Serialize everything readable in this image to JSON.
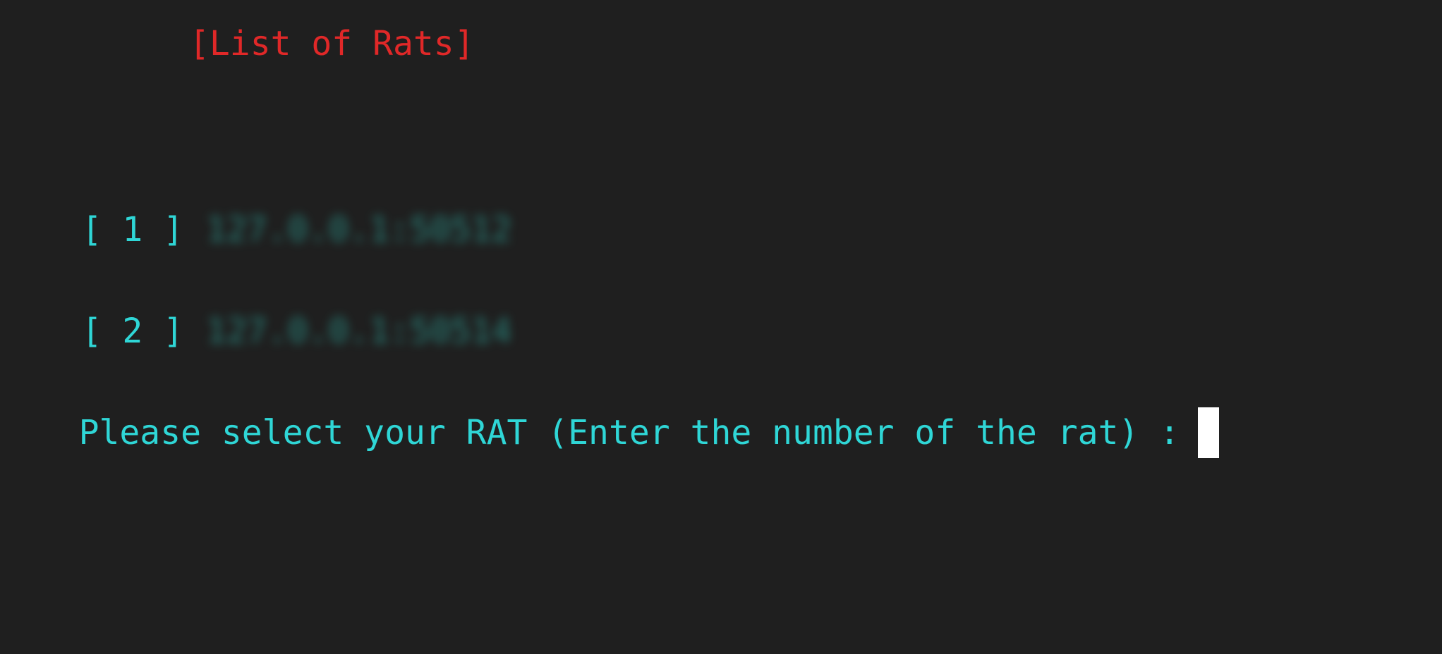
{
  "title": "[List of Rats]",
  "rats": [
    {
      "index": "[ 1 ]",
      "address": "127.0.0.1:50512"
    },
    {
      "index": "[ 2 ]",
      "address": "127.0.0.1:50514"
    }
  ],
  "prompt": "Please select your RAT (Enter the number of the rat) :",
  "colors": {
    "background": "#1f1f1f",
    "title": "#e02828",
    "text": "#2fd6d6",
    "cursor": "#ffffff"
  }
}
